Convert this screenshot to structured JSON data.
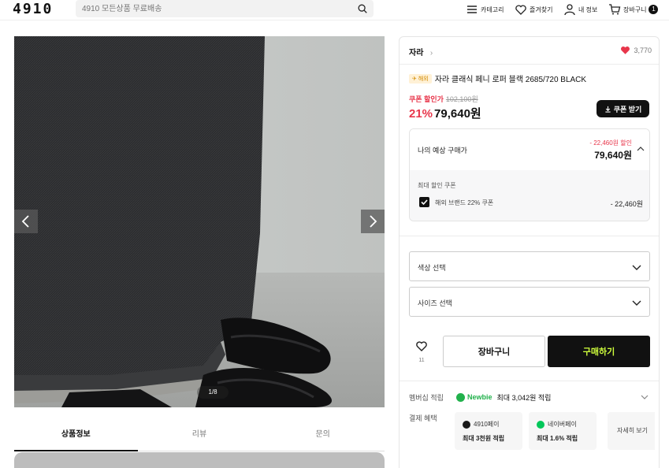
{
  "header": {
    "logo": "4910",
    "search_placeholder": "4910 모든상품 무료배송",
    "nav": [
      {
        "label": "카테고리",
        "icon": "menu-icon"
      },
      {
        "label": "즐겨찾기",
        "icon": "heart-outline-icon"
      },
      {
        "label": "내 정보",
        "icon": "user-icon"
      },
      {
        "label": "장바구니",
        "icon": "cart-icon"
      }
    ],
    "cart_count": "1"
  },
  "gallery": {
    "page_indicator": "1/8"
  },
  "tabs": [
    {
      "label": "상품정보",
      "active": true
    },
    {
      "label": "리뷰",
      "active": false
    },
    {
      "label": "문의",
      "active": false
    }
  ],
  "product": {
    "brand": "자라",
    "likes": "3,770",
    "overseas_badge": "해외",
    "title": "자라 클래식 페니 로퍼 블랙 2685/720 BLACK",
    "coupon_label": "쿠폰 할인가",
    "original_price": "102,100원",
    "discount_percent": "21%",
    "price": "79,640원",
    "coupon_button": "쿠폰 받기"
  },
  "estimate": {
    "label": "나의 예상 구매가",
    "discount_text": "- 22,460원 할인",
    "price": "79,640원",
    "max_coupon_label": "최대 할인 쿠폰",
    "coupon_name": "해외 브랜드 22% 쿠폰",
    "coupon_amount": "- 22,460원"
  },
  "options": {
    "color_placeholder": "색상 선택",
    "size_placeholder": "사이즈 선택"
  },
  "actions": {
    "wish_count": "11",
    "cart_label": "장바구니",
    "buy_label": "구매하기"
  },
  "benefits": {
    "membership_label": "멤버십 적립",
    "membership_tier": "Newbie",
    "membership_text": "최대 3,042원 적립",
    "payment_label": "결제 혜택",
    "payments": [
      {
        "name": "4910페이",
        "value": "최대 3천원 적립",
        "color": "#1a1a1a"
      },
      {
        "name": "네이버페이",
        "value": "최대 1.6% 적립",
        "color": "#03c75a"
      }
    ],
    "more_label": "자세히 보기"
  }
}
